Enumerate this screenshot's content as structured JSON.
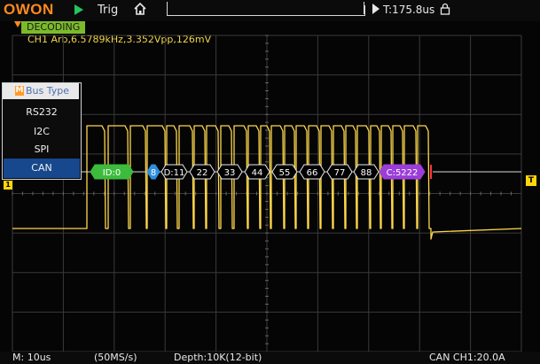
{
  "brand": "OWON",
  "topbar": {
    "trig_label": "Trig",
    "trigger_time": "T:175.8us"
  },
  "status": {
    "decoding_label": "DECODING",
    "ch1_info": "CH1 Arb,6.5789kHz,3.352Vpp,126mV"
  },
  "menu": {
    "badge": "M",
    "title": "Bus Type",
    "items": [
      {
        "label": "RS232"
      },
      {
        "label": "I2C"
      },
      {
        "label": "SPI"
      },
      {
        "label": "CAN"
      }
    ],
    "selected": "CAN"
  },
  "markers": {
    "channel": "1",
    "trigger": "T"
  },
  "decode_frames": [
    {
      "label": "ID:0",
      "kind": "id",
      "color": "#3dbb3d"
    },
    {
      "label": "8",
      "kind": "dlc",
      "color": "#2d8fe0"
    },
    {
      "label": "D:11",
      "kind": "data",
      "color": "#000000"
    },
    {
      "label": "22",
      "kind": "data",
      "color": "#000000"
    },
    {
      "label": "33",
      "kind": "data",
      "color": "#000000"
    },
    {
      "label": "44",
      "kind": "data",
      "color": "#000000"
    },
    {
      "label": "55",
      "kind": "data",
      "color": "#000000"
    },
    {
      "label": "66",
      "kind": "data",
      "color": "#000000"
    },
    {
      "label": "77",
      "kind": "data",
      "color": "#000000"
    },
    {
      "label": "88",
      "kind": "data",
      "color": "#000000"
    },
    {
      "label": "C:5222",
      "kind": "crc",
      "color": "#9b3dd9"
    }
  ],
  "bottombar": {
    "timebase": "M: 10us",
    "sample_rate": "(50MS/s)",
    "depth": "Depth:10K(12-bit)",
    "trigger_info": "CAN CH1:20.0A"
  },
  "colors": {
    "waveform": "#ffd84a",
    "grid": "#3a3a3a",
    "brand": "#ff8a1e",
    "decoding_badge": "#7bbb2a"
  }
}
